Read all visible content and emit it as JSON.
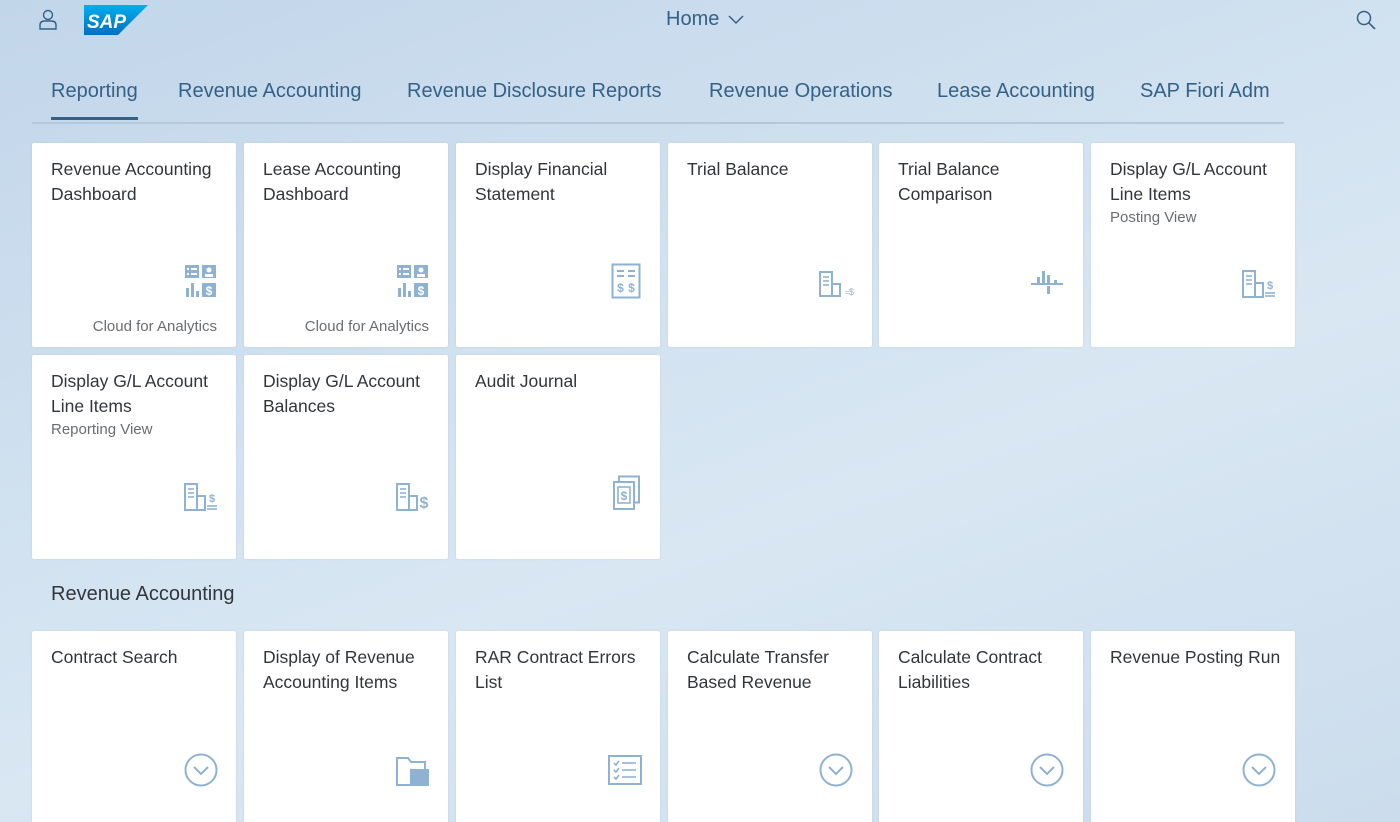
{
  "shell": {
    "home_label": "Home"
  },
  "tabs": [
    {
      "label": "Reporting",
      "active": true
    },
    {
      "label": "Revenue Accounting",
      "active": false
    },
    {
      "label": "Revenue Disclosure Reports",
      "active": false
    },
    {
      "label": "Revenue Operations",
      "active": false
    },
    {
      "label": "Lease Accounting",
      "active": false
    },
    {
      "label": "SAP Fiori Adm",
      "active": false
    }
  ],
  "reporting_tiles": [
    {
      "title": "Revenue Accounting Dashboard",
      "footer": "Cloud for Analytics",
      "icon": "dashboard-icon"
    },
    {
      "title": "Lease Accounting Dashboard",
      "footer": "Cloud for Analytics",
      "icon": "dashboard-icon"
    },
    {
      "title": "Display Financial Statement",
      "icon": "financial-statement-icon"
    },
    {
      "title": "Trial Balance",
      "icon": "trial-balance-icon"
    },
    {
      "title": "Trial Balance Comparison",
      "icon": "comparison-chart-icon"
    },
    {
      "title": "Display G/L Account Line Items",
      "subtitle": "Posting View",
      "icon": "gl-line-items-icon"
    },
    {
      "title": "Display G/L Account Line Items",
      "subtitle": "Reporting View",
      "icon": "gl-line-items-icon"
    },
    {
      "title": "Display G/L Account Balances",
      "icon": "gl-balances-icon"
    },
    {
      "title": "Audit Journal",
      "icon": "audit-journal-icon"
    }
  ],
  "revenue_section": {
    "title": "Revenue Accounting",
    "tiles": [
      {
        "title": "Contract Search",
        "icon": "chevron-circle-icon"
      },
      {
        "title": "Display of Revenue Accounting Items",
        "icon": "folder-icon"
      },
      {
        "title": "RAR Contract Errors List",
        "icon": "checklist-icon"
      },
      {
        "title": "Calculate Transfer Based Revenue",
        "icon": "chevron-circle-icon"
      },
      {
        "title": "Calculate Contract Liabilities",
        "icon": "chevron-circle-icon"
      },
      {
        "title": "Revenue Posting Run",
        "icon": "chevron-circle-icon"
      }
    ]
  },
  "colors": {
    "accent": "#346187",
    "icon": "#8fb2d3",
    "tile_bg": "#ffffff"
  }
}
